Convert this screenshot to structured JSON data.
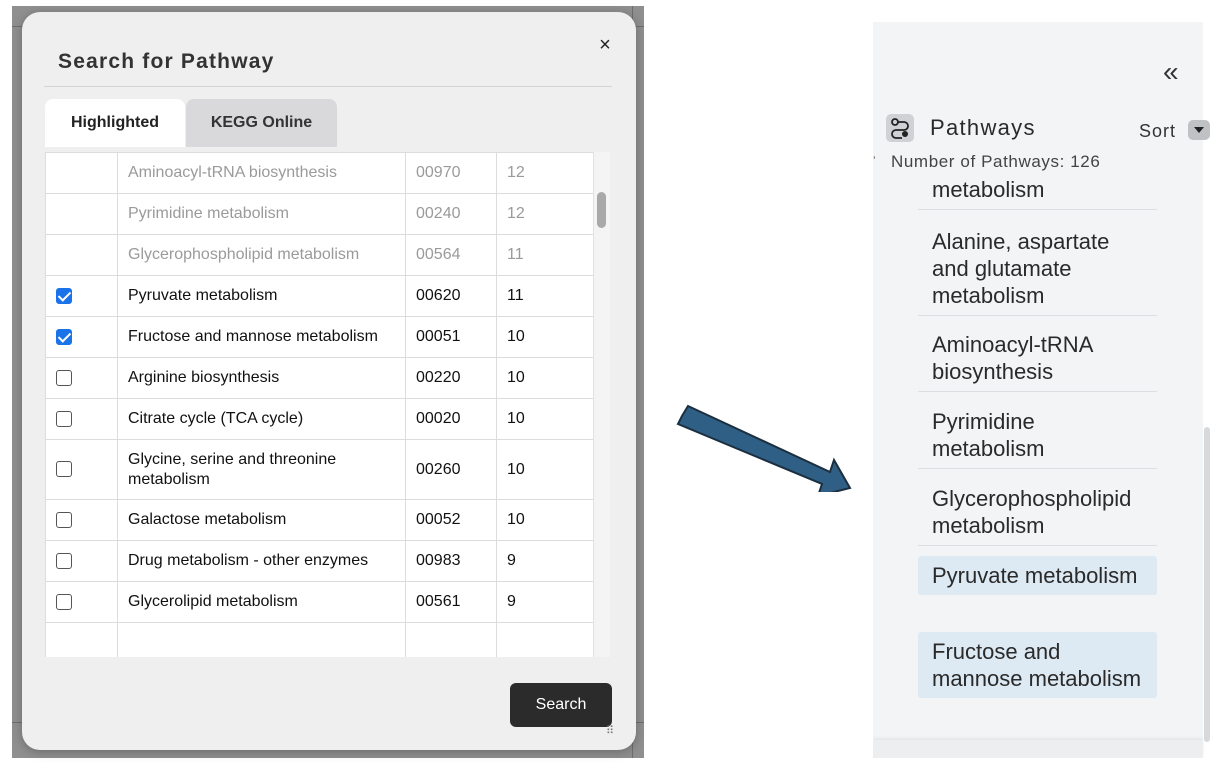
{
  "modal": {
    "title": "Search for Pathway",
    "close_glyph": "×",
    "tabs": [
      {
        "label": "Highlighted",
        "active": true
      },
      {
        "label": "KEGG Online",
        "active": false
      }
    ],
    "rows": [
      {
        "name": "Aminoacyl-tRNA biosynthesis",
        "id": "00970",
        "count": "12",
        "checked": null,
        "dim": true
      },
      {
        "name": "Pyrimidine metabolism",
        "id": "00240",
        "count": "12",
        "checked": null,
        "dim": true
      },
      {
        "name": "Glycerophospholipid metabolism",
        "id": "00564",
        "count": "11",
        "checked": null,
        "dim": true
      },
      {
        "name": "Pyruvate metabolism",
        "id": "00620",
        "count": "11",
        "checked": true,
        "dim": false
      },
      {
        "name": "Fructose and mannose metabolism",
        "id": "00051",
        "count": "10",
        "checked": true,
        "dim": false
      },
      {
        "name": "Arginine biosynthesis",
        "id": "00220",
        "count": "10",
        "checked": false,
        "dim": false
      },
      {
        "name": "Citrate cycle (TCA cycle)",
        "id": "00020",
        "count": "10",
        "checked": false,
        "dim": false
      },
      {
        "name": "Glycine, serine and threonine metabolism",
        "id": "00260",
        "count": "10",
        "checked": false,
        "dim": false
      },
      {
        "name": "Galactose metabolism",
        "id": "00052",
        "count": "10",
        "checked": false,
        "dim": false
      },
      {
        "name": "Drug metabolism - other enzymes",
        "id": "00983",
        "count": "9",
        "checked": false,
        "dim": false
      },
      {
        "name": "Glycerolipid metabolism",
        "id": "00561",
        "count": "9",
        "checked": false,
        "dim": false
      }
    ],
    "search_label": "Search",
    "colors": {
      "checkbox_accent": "#1a73e8",
      "search_button": "#2b2b2b"
    }
  },
  "arrow": {
    "icon": "arrow-right-icon",
    "color": "#2f5f85"
  },
  "panel": {
    "collapse_glyph": "«",
    "icon": "pathway-icon",
    "title": "Pathways",
    "sort_label": "Sort",
    "count_text": "Number of Pathways: 126",
    "items": [
      {
        "label": "metabolism",
        "selected": false
      },
      {
        "label": "Alanine, aspartate and glutamate metabolism",
        "selected": false
      },
      {
        "label": "Aminoacyl-tRNA biosynthesis",
        "selected": false
      },
      {
        "label": "Pyrimidine metabolism",
        "selected": false
      },
      {
        "label": "Glycerophospholipid metabolism",
        "selected": false
      },
      {
        "label": "Pyruvate metabolism",
        "selected": true
      },
      {
        "label": "Fructose and mannose metabolism",
        "selected": true
      }
    ],
    "colors": {
      "selected_bg": "#dde9f3"
    }
  }
}
